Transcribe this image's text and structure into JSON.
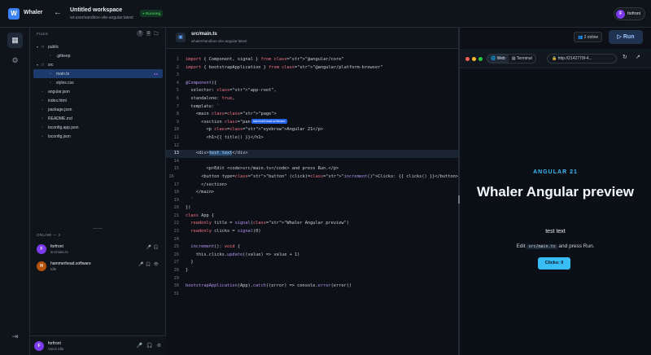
{
  "app": {
    "logo": "W",
    "name": "Whaler"
  },
  "workspace": {
    "title": "Untitled workspace",
    "subtitle": "wt-user/sandbox-vite-angular:latest",
    "status": "Running"
  },
  "user": {
    "initial": "F",
    "name": "forfront"
  },
  "files": {
    "heading": "FILES",
    "tree": [
      {
        "name": "public",
        "type": "folder",
        "depth": 0
      },
      {
        "name": ".gitkeep",
        "type": "file",
        "depth": 1
      },
      {
        "name": "src",
        "type": "folder",
        "depth": 0
      },
      {
        "name": "main.ts",
        "type": "file",
        "depth": 1,
        "selected": true
      },
      {
        "name": "styles.css",
        "type": "file",
        "depth": 1
      },
      {
        "name": "angular.json",
        "type": "file",
        "depth": 0
      },
      {
        "name": "index.html",
        "type": "file",
        "depth": 0
      },
      {
        "name": "package.json",
        "type": "file",
        "depth": 0
      },
      {
        "name": "README.md",
        "type": "file",
        "depth": 0
      },
      {
        "name": "tsconfig.app.json",
        "type": "file",
        "depth": 0
      },
      {
        "name": "tsconfig.json",
        "type": "file",
        "depth": 0
      }
    ]
  },
  "online": {
    "heading": "ONLINE — 2",
    "users": [
      {
        "initial": "F",
        "name": "forfront",
        "sub": "src/main.ts",
        "color": "#7c3aed"
      },
      {
        "initial": "H",
        "name": "hammerhead.software",
        "sub": "Idle",
        "color": "#b45309"
      }
    ]
  },
  "me": {
    "initial": "F",
    "name": "forfront",
    "sub": "Voice idle"
  },
  "editor": {
    "file": "src/main.ts",
    "subtitle": "whaler/sandbox-vite-angular:latest",
    "remote_cursor_label": "hammerhead.software",
    "highlight_line": 13,
    "lines": [
      "import { Component, signal } from \"@angular/core\"",
      "import { bootstrapApplication } from \"@angular/platform-browser\"",
      "",
      "@Component({",
      "  selector: \"app-root\",",
      "  standalone: true,",
      "  template: `",
      "    <main class=\"page\">",
      "      <section class=\"pan",
      "        <p class=\"eyebrow\">Angular 21</p>",
      "        <h1>{{ title() }}</h1>",
      "",
      "    <div>test text</div>",
      "",
      "        <p>Edit <code>src/main.ts</code> and press Run.</p>",
      "        <button type=\"button\" (click)=\"increment()\">Clicks: {{ clicks() }}</button>",
      "      </section>",
      "    </main>",
      "  `",
      "})",
      "class App {",
      "  readonly title = signal(\"Whaler Angular preview\")",
      "  readonly clicks = signal(0)",
      "",
      "  increment(): void {",
      "    this.clicks.update((value) => value + 1)",
      "  }",
      "}",
      "",
      "bootstrapApplication(App).catch((error) => console.error(error))",
      ""
    ]
  },
  "collab": {
    "count_label": "2 online"
  },
  "run": {
    "label": "Run"
  },
  "preview": {
    "tabs": [
      "Web",
      "Terminal"
    ],
    "url": "http://2142779f-4...",
    "kicker": "ANGULAR 21",
    "heading": "Whaler Angular preview",
    "body_text": "test text",
    "edit_prefix": "Edit",
    "edit_code": "src/main.ts",
    "edit_suffix": "and press Run.",
    "button": "Clicks: 0"
  }
}
